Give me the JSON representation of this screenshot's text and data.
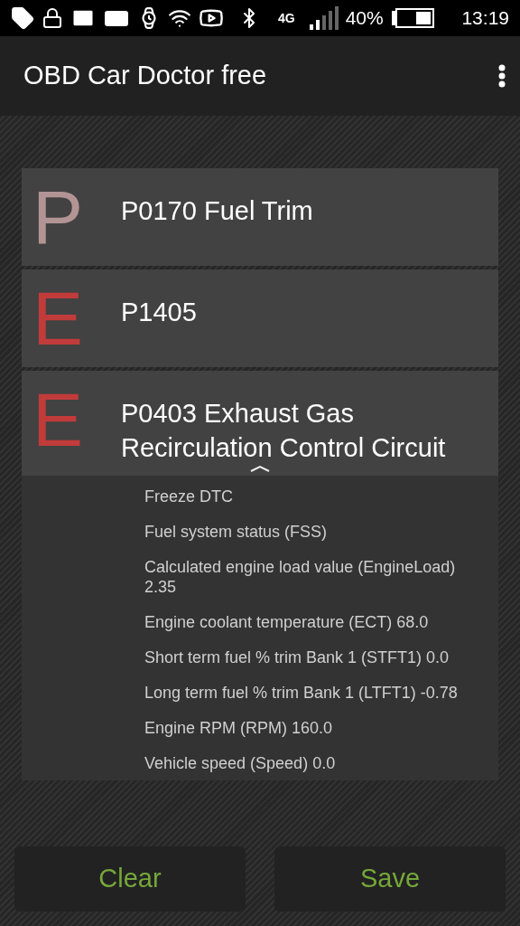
{
  "status_bar": {
    "network": "4G",
    "battery": "40%",
    "time": "13:19"
  },
  "app_bar": {
    "title": "OBD Car Doctor free"
  },
  "codes": [
    {
      "letter": "P",
      "color": "#b39494",
      "code": "P0170",
      "description": "Fuel Trim",
      "expanded": false
    },
    {
      "letter": "E",
      "color": "#c23b3b",
      "code": "P1405",
      "expanded": false
    },
    {
      "letter": "E",
      "color": "#c23b3b",
      "code": "P0403",
      "description": "Exhaust Gas Recirculation Control Circuit",
      "expanded": true,
      "details": [
        "Freeze DTC",
        "Fuel system status (FSS)",
        "Calculated engine load value (EngineLoad) 2.35",
        "Engine coolant temperature (ECT) 68.0",
        "Short term fuel % trim Bank 1 (STFT1) 0.0",
        "Long term fuel % trim Bank 1 (LTFT1) -0.78",
        "Engine RPM (RPM) 160.0",
        "Vehicle speed (Speed) 0.0"
      ]
    }
  ],
  "buttons": [
    "Clear",
    "Save"
  ]
}
